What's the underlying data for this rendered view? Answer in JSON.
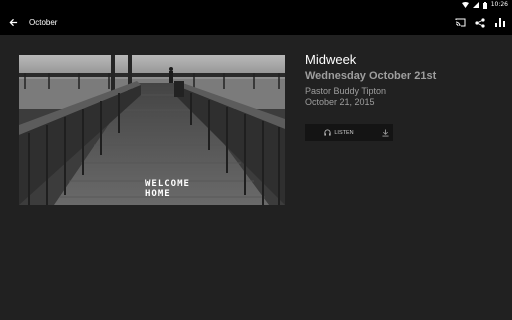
{
  "status_bar": {
    "time": "10:26"
  },
  "toolbar": {
    "title": "October"
  },
  "hero": {
    "overlay_text": "WELCOME HOME"
  },
  "message": {
    "series": "Midweek",
    "title": "Wednesday October 21st",
    "speaker": "Pastor Buddy Tipton",
    "date": "October 21, 2015"
  },
  "actions": {
    "listen_label": "LISTEN"
  },
  "icons": {
    "back": "arrow-left-icon",
    "cast": "cast-icon",
    "share": "share-icon",
    "stats": "bar-chart-icon",
    "headphones": "headphones-icon",
    "download": "download-icon"
  }
}
